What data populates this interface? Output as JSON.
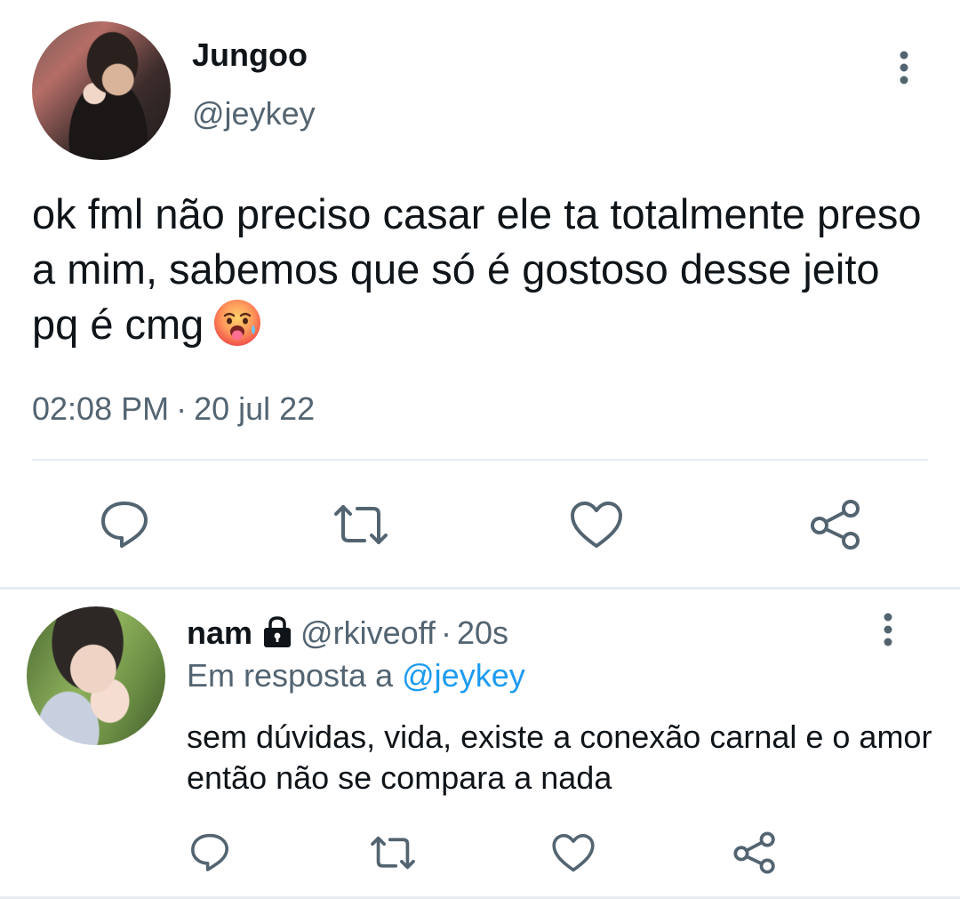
{
  "tweet": {
    "display_name": "Jungoo",
    "handle": "@jeykey",
    "text": "ok fml não preciso casar ele ta totalmente preso a mim, sabemos que só é gostoso desse jeito pq é cmg",
    "emoji": "hot-face-emoji",
    "time": "02:08 PM",
    "separator": "·",
    "date": "20 jul 22",
    "actions": [
      "reply-icon",
      "retweet-icon",
      "like-icon",
      "share-icon"
    ]
  },
  "reply": {
    "display_name": "nam",
    "locked_icon": "lock-icon",
    "handle": "@rkiveoff",
    "separator": "·",
    "time": "20s",
    "reply_to_prefix": "Em resposta a",
    "reply_to_handle": "@jeykey",
    "text": "sem dúvidas, vida, existe a conexão carnal e o amor então não se compara a nada",
    "actions": [
      "reply-icon",
      "retweet-icon",
      "like-icon",
      "share-icon"
    ]
  },
  "colors": {
    "text": "#0f1419",
    "secondary": "#536471",
    "link": "#1d9bf0",
    "divider": "#e6ecf0"
  }
}
